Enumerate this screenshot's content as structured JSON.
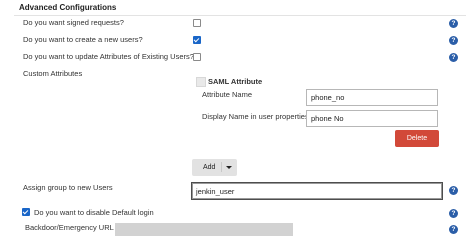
{
  "section": {
    "title": "Advanced Configurations"
  },
  "options": {
    "signed_requests": {
      "label": "Do you want signed requests?",
      "checked": false
    },
    "create_users": {
      "label": "Do you want to create a new users?",
      "checked": true
    },
    "update_attributes": {
      "label": "Do you want to update Attributes of Existing Users?",
      "checked": false
    }
  },
  "custom_attributes": {
    "label": "Custom Attributes",
    "saml_heading": "SAML Attribute",
    "attribute_name_label": "Attribute Name",
    "attribute_name_value": "phone_no",
    "display_name_label": "Display Name in user properties",
    "display_name_value": "phone No",
    "delete_label": "Delete",
    "add_label": "Add"
  },
  "assign_group": {
    "label": "Assign group to new Users",
    "value": "jenkin_user"
  },
  "disable_default_login": {
    "label": "Do you want to disable Default login",
    "checked": true
  },
  "backdoor": {
    "label": "Backdoor/Emergency URL"
  },
  "help_glyph": "?",
  "colors": {
    "accent": "#1a66c8",
    "help": "#2b5ea8",
    "delete": "#d24939"
  }
}
